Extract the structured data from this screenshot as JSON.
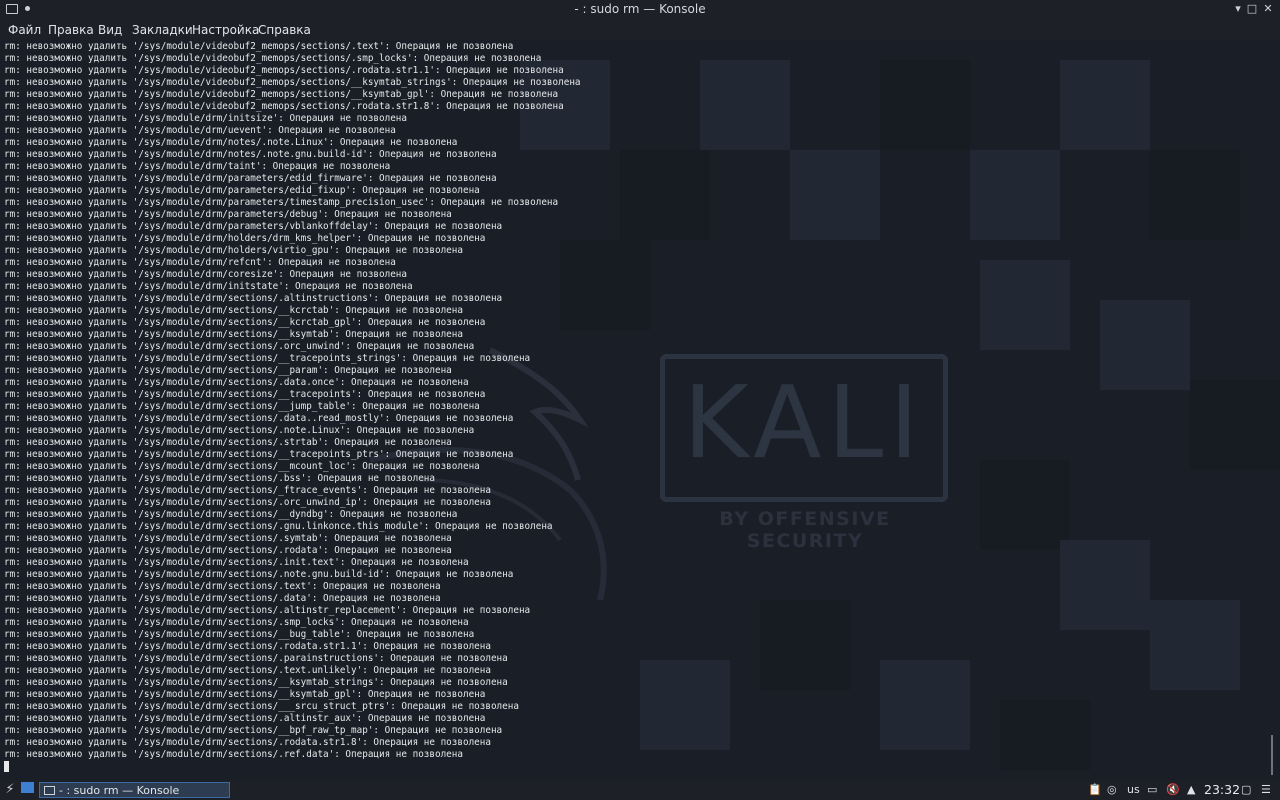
{
  "window": {
    "title": "- : sudo rm — Konsole",
    "dot": "●",
    "buttons": {
      "minimize": "▾",
      "maximize": "□",
      "close": "✕"
    }
  },
  "menu": [
    "Файл",
    "Правка",
    "Вид",
    "Закладки",
    "Настройка",
    "Справка"
  ],
  "wallpaper": {
    "logo_text": "KALI",
    "tagline": "BY OFFENSIVE SECURITY"
  },
  "terminal": {
    "lines": [
      "rm: невозможно удалить '/sys/module/videobuf2_memops/sections/.text': Операция не позволена",
      "rm: невозможно удалить '/sys/module/videobuf2_memops/sections/.smp_locks': Операция не позволена",
      "rm: невозможно удалить '/sys/module/videobuf2_memops/sections/.rodata.str1.1': Операция не позволена",
      "rm: невозможно удалить '/sys/module/videobuf2_memops/sections/__ksymtab_strings': Операция не позволена",
      "rm: невозможно удалить '/sys/module/videobuf2_memops/sections/__ksymtab_gpl': Операция не позволена",
      "rm: невозможно удалить '/sys/module/videobuf2_memops/sections/.rodata.str1.8': Операция не позволена",
      "rm: невозможно удалить '/sys/module/drm/initsize': Операция не позволена",
      "rm: невозможно удалить '/sys/module/drm/uevent': Операция не позволена",
      "rm: невозможно удалить '/sys/module/drm/notes/.note.Linux': Операция не позволена",
      "rm: невозможно удалить '/sys/module/drm/notes/.note.gnu.build-id': Операция не позволена",
      "rm: невозможно удалить '/sys/module/drm/taint': Операция не позволена",
      "rm: невозможно удалить '/sys/module/drm/parameters/edid_firmware': Операция не позволена",
      "rm: невозможно удалить '/sys/module/drm/parameters/edid_fixup': Операция не позволена",
      "rm: невозможно удалить '/sys/module/drm/parameters/timestamp_precision_usec': Операция не позволена",
      "rm: невозможно удалить '/sys/module/drm/parameters/debug': Операция не позволена",
      "rm: невозможно удалить '/sys/module/drm/parameters/vblankoffdelay': Операция не позволена",
      "rm: невозможно удалить '/sys/module/drm/holders/drm_kms_helper': Операция не позволена",
      "rm: невозможно удалить '/sys/module/drm/holders/virtio_gpu': Операция не позволена",
      "rm: невозможно удалить '/sys/module/drm/refcnt': Операция не позволена",
      "rm: невозможно удалить '/sys/module/drm/coresize': Операция не позволена",
      "rm: невозможно удалить '/sys/module/drm/initstate': Операция не позволена",
      "rm: невозможно удалить '/sys/module/drm/sections/.altinstructions': Операция не позволена",
      "rm: невозможно удалить '/sys/module/drm/sections/__kcrctab': Операция не позволена",
      "rm: невозможно удалить '/sys/module/drm/sections/__kcrctab_gpl': Операция не позволена",
      "rm: невозможно удалить '/sys/module/drm/sections/__ksymtab': Операция не позволена",
      "rm: невозможно удалить '/sys/module/drm/sections/.orc_unwind': Операция не позволена",
      "rm: невозможно удалить '/sys/module/drm/sections/__tracepoints_strings': Операция не позволена",
      "rm: невозможно удалить '/sys/module/drm/sections/__param': Операция не позволена",
      "rm: невозможно удалить '/sys/module/drm/sections/.data.once': Операция не позволена",
      "rm: невозможно удалить '/sys/module/drm/sections/__tracepoints': Операция не позволена",
      "rm: невозможно удалить '/sys/module/drm/sections/__jump_table': Операция не позволена",
      "rm: невозможно удалить '/sys/module/drm/sections/.data..read_mostly': Операция не позволена",
      "rm: невозможно удалить '/sys/module/drm/sections/.note.Linux': Операция не позволена",
      "rm: невозможно удалить '/sys/module/drm/sections/.strtab': Операция не позволена",
      "rm: невозможно удалить '/sys/module/drm/sections/__tracepoints_ptrs': Операция не позволена",
      "rm: невозможно удалить '/sys/module/drm/sections/__mcount_loc': Операция не позволена",
      "rm: невозможно удалить '/sys/module/drm/sections/.bss': Операция не позволена",
      "rm: невозможно удалить '/sys/module/drm/sections/_ftrace_events': Операция не позволена",
      "rm: невозможно удалить '/sys/module/drm/sections/.orc_unwind_ip': Операция не позволена",
      "rm: невозможно удалить '/sys/module/drm/sections/__dyndbg': Операция не позволена",
      "rm: невозможно удалить '/sys/module/drm/sections/.gnu.linkonce.this_module': Операция не позволена",
      "rm: невозможно удалить '/sys/module/drm/sections/.symtab': Операция не позволена",
      "rm: невозможно удалить '/sys/module/drm/sections/.rodata': Операция не позволена",
      "rm: невозможно удалить '/sys/module/drm/sections/.init.text': Операция не позволена",
      "rm: невозможно удалить '/sys/module/drm/sections/.note.gnu.build-id': Операция не позволена",
      "rm: невозможно удалить '/sys/module/drm/sections/.text': Операция не позволена",
      "rm: невозможно удалить '/sys/module/drm/sections/.data': Операция не позволена",
      "rm: невозможно удалить '/sys/module/drm/sections/.altinstr_replacement': Операция не позволена",
      "rm: невозможно удалить '/sys/module/drm/sections/.smp_locks': Операция не позволена",
      "rm: невозможно удалить '/sys/module/drm/sections/__bug_table': Операция не позволена",
      "rm: невозможно удалить '/sys/module/drm/sections/.rodata.str1.1': Операция не позволена",
      "rm: невозможно удалить '/sys/module/drm/sections/.parainstructions': Операция не позволена",
      "rm: невозможно удалить '/sys/module/drm/sections/.text.unlikely': Операция не позволена",
      "rm: невозможно удалить '/sys/module/drm/sections/__ksymtab_strings': Операция не позволена",
      "rm: невозможно удалить '/sys/module/drm/sections/__ksymtab_gpl': Операция не позволена",
      "rm: невозможно удалить '/sys/module/drm/sections/___srcu_struct_ptrs': Операция не позволена",
      "rm: невозможно удалить '/sys/module/drm/sections/.altinstr_aux': Операция не позволена",
      "rm: невозможно удалить '/sys/module/drm/sections/__bpf_raw_tp_map': Операция не позволена",
      "rm: невозможно удалить '/sys/module/drm/sections/.rodata.str1.8': Операция не позволена",
      "rm: невозможно удалить '/sys/module/drm/sections/.ref.data': Операция не позволена"
    ]
  },
  "taskbar": {
    "task_label": "- : sudo rm — Konsole",
    "keyboard_layout": "us",
    "clock": "23:32"
  }
}
